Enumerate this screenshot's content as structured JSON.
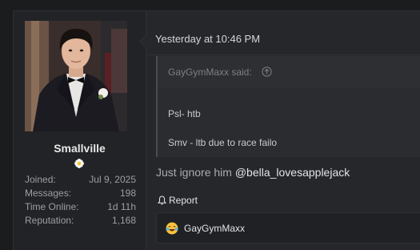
{
  "post": {
    "timestamp": "Yesterday at 10:46 PM"
  },
  "user": {
    "name": "Smallville",
    "flair_icon": "daisy-flower-icon",
    "stats": [
      {
        "label": "Joined:",
        "value": "Jul 9, 2025"
      },
      {
        "label": "Messages:",
        "value": "198"
      },
      {
        "label": "Time Online:",
        "value": "1d 11h"
      },
      {
        "label": "Reputation:",
        "value": "1,168"
      }
    ]
  },
  "quote": {
    "author": "GayGymMaxx said:",
    "lines": [
      "Psl- htb",
      "Smv - ltb due to race failo"
    ]
  },
  "reply": {
    "text": "Just ignore him ",
    "mention": "@bella_lovesapplejack"
  },
  "actions": {
    "report_label": "Report"
  },
  "reactions": {
    "emoji": "tears-of-joy-emoji",
    "user": "GayGymMaxx"
  }
}
